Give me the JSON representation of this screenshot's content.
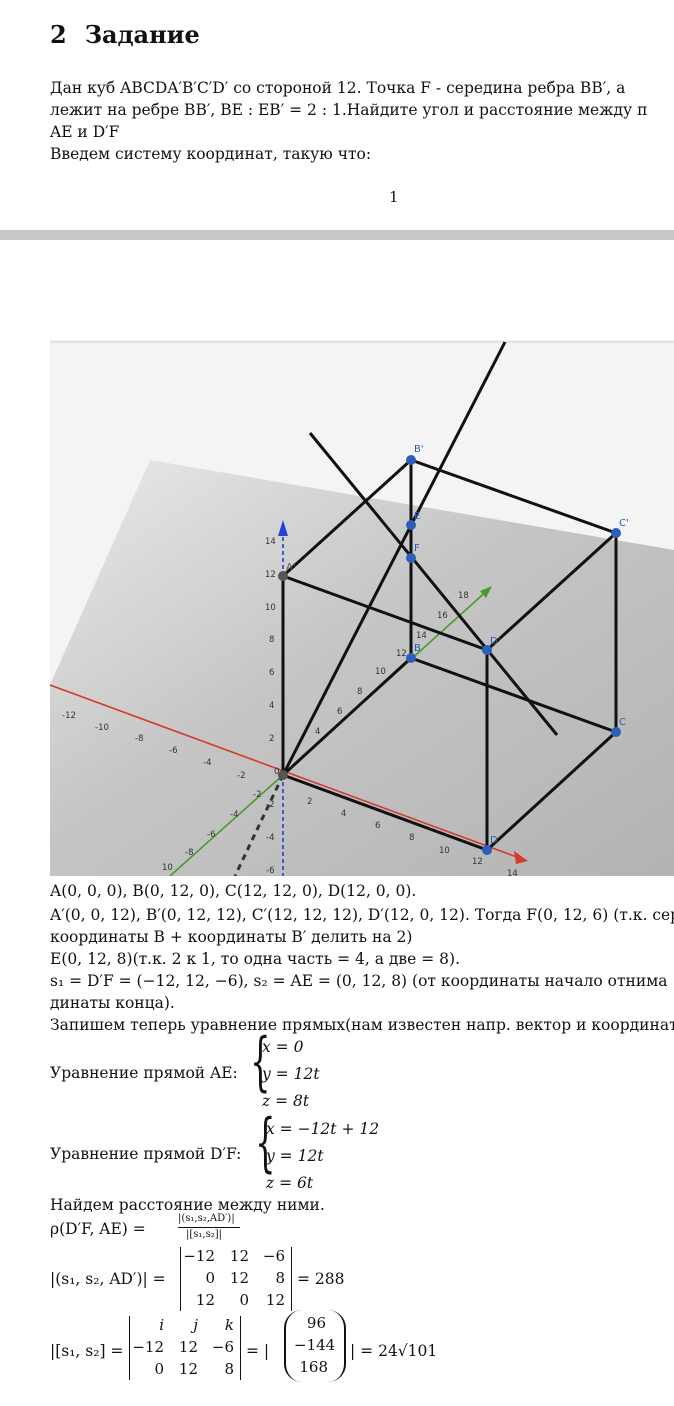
{
  "section": {
    "number": "2",
    "title": "Задание"
  },
  "intro": {
    "line1": "Дан куб ABCDA′B′C′D′ со стороной 12. Точка F - середина ребра BB′, а",
    "line2": "лежит на ребре BB′, BE : EB′ = 2 : 1.Найдите угол и расстояние между п",
    "line3": "AE и D′F",
    "line4": "Введем систему координат, такую что:"
  },
  "page_number": "1",
  "figure": {
    "point_labels": [
      "A'",
      "B'",
      "C'",
      "D'",
      "B",
      "C",
      "D",
      "E",
      "F"
    ],
    "z_ticks": [
      "14",
      "12",
      "10",
      "8",
      "6",
      "4",
      "2",
      "0",
      "-2",
      "-4",
      "-6"
    ],
    "x_neg_ticks": [
      "-12",
      "-10",
      "-8",
      "-6",
      "-4",
      "-2"
    ],
    "x_pos_ticks": [
      "2",
      "4",
      "6",
      "8",
      "10",
      "12",
      "14"
    ],
    "y_ticks": [
      "4",
      "6",
      "8",
      "10",
      "12",
      "14",
      "16",
      "18"
    ],
    "y_neg_ticks": [
      "-2",
      "-4",
      "-6",
      "-8",
      "10"
    ],
    "colors": {
      "x_axis": "#d43b2e",
      "y_axis": "#4a9a2a",
      "z_axis": "#2440d8",
      "point": "#2b5fb8",
      "plane": "#b0b0b0"
    }
  },
  "body": {
    "l1": "A(0, 0, 0), B(0, 12, 0), C(12, 12, 0), D(12, 0, 0).",
    "l2": "A′(0, 0, 12), B′(0, 12, 12), C′(12, 12, 12), D′(12, 0, 12). Тогда F(0, 12, 6) (т.к. серед",
    "l3": "координаты B + координаты B′ делить на 2)",
    "l4": "E(0, 12, 8)(т.к. 2 к 1, то одна часть = 4, а две = 8).",
    "l5": "s₁ = D′F = (−12, 12, −6), s₂ = AE = (0, 12, 8) (от координаты начало отнима",
    "l6": "динаты конца).",
    "l7": "Запишем теперь уравнение прямых(нам известен напр. вектор и координата",
    "eq1_label": "Уравнение прямой AE:",
    "eq1": [
      "x = 0",
      "y = 12t",
      "z = 8t"
    ],
    "eq2_label": "Уравнение прямой D′F:",
    "eq2": [
      "x = −12t + 12",
      "y = 12t",
      "z = 6t"
    ],
    "l8": "Найдем расстояние между ними.",
    "rho_left": "ρ(D′F, AE) =",
    "rho_num": "|(s₁,s₂,AD′)|",
    "rho_den": "|[s₁,s₂]|",
    "mixed_left": "|(s₁, s₂, AD′)| =",
    "mixed_matrix": [
      [
        "−12",
        "12",
        "−6"
      ],
      [
        "0",
        "12",
        "8"
      ],
      [
        "12",
        "0",
        "12"
      ]
    ],
    "mixed_result": "= 288",
    "cross_left": "|[s₁, s₂] =",
    "cross_matrix": [
      [
        "i",
        "j",
        "k"
      ],
      [
        "−12",
        "12",
        "−6"
      ],
      [
        "0",
        "12",
        "8"
      ]
    ],
    "cross_eq": "= |",
    "cross_vector": [
      "96",
      "−144",
      "168"
    ],
    "cross_result": "| = 24√101"
  }
}
